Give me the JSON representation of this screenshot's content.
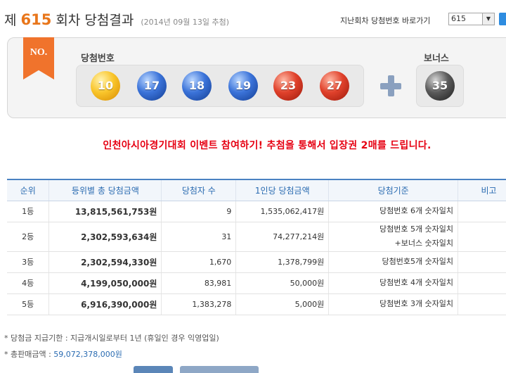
{
  "header": {
    "prefix": "제",
    "round": "615",
    "suffix": "회차 당첨결과",
    "draw_date": "(2014년 09월 13일 추첨)",
    "nav_label": "지난회차 당첨번호 바로가기",
    "selected_round": "615"
  },
  "draw": {
    "badge": "NO.",
    "winning_label": "당첨번호",
    "bonus_label": "보너스",
    "numbers": [
      "10",
      "17",
      "18",
      "19",
      "23",
      "27"
    ],
    "bonus": "35"
  },
  "event_link": "인천아시아경기대회 이벤트 참여하기! 추첨을 통해서 입장권 2매를 드립니다.",
  "table": {
    "headers": [
      "순위",
      "등위별 총 당첨금액",
      "당첨자 수",
      "1인당 당첨금액",
      "당첨기준",
      "비고"
    ],
    "rows": [
      {
        "rank": "1등",
        "total": "13,815,561,753원",
        "count": "9",
        "per": "1,535,062,417원",
        "crit": "당첨번호 6개 숫자일치",
        "crit2": ""
      },
      {
        "rank": "2등",
        "total": "2,302,593,634원",
        "count": "31",
        "per": "74,277,214원",
        "crit": "당첨번호 5개 숫자일치",
        "crit2": "+보너스 숫자일치"
      },
      {
        "rank": "3등",
        "total": "2,302,594,330원",
        "count": "1,670",
        "per": "1,378,799원",
        "crit": "당첨번호5개 숫자일치",
        "crit2": ""
      },
      {
        "rank": "4등",
        "total": "4,199,050,000원",
        "count": "83,981",
        "per": "50,000원",
        "crit": "당첨번호 4개 숫자일치",
        "crit2": ""
      },
      {
        "rank": "5등",
        "total": "6,916,390,000원",
        "count": "1,383,278",
        "per": "5,000원",
        "crit": "당첨번호 3개 숫자일치",
        "crit2": ""
      }
    ]
  },
  "notes": {
    "claim_period": "* 당첨금 지급기한 : 지급개시일로부터 1년 (휴일인 경우 익영업일)",
    "total_sales_label": "* 총판매금액 : ",
    "total_sales_value": "59,072,378,000원"
  }
}
